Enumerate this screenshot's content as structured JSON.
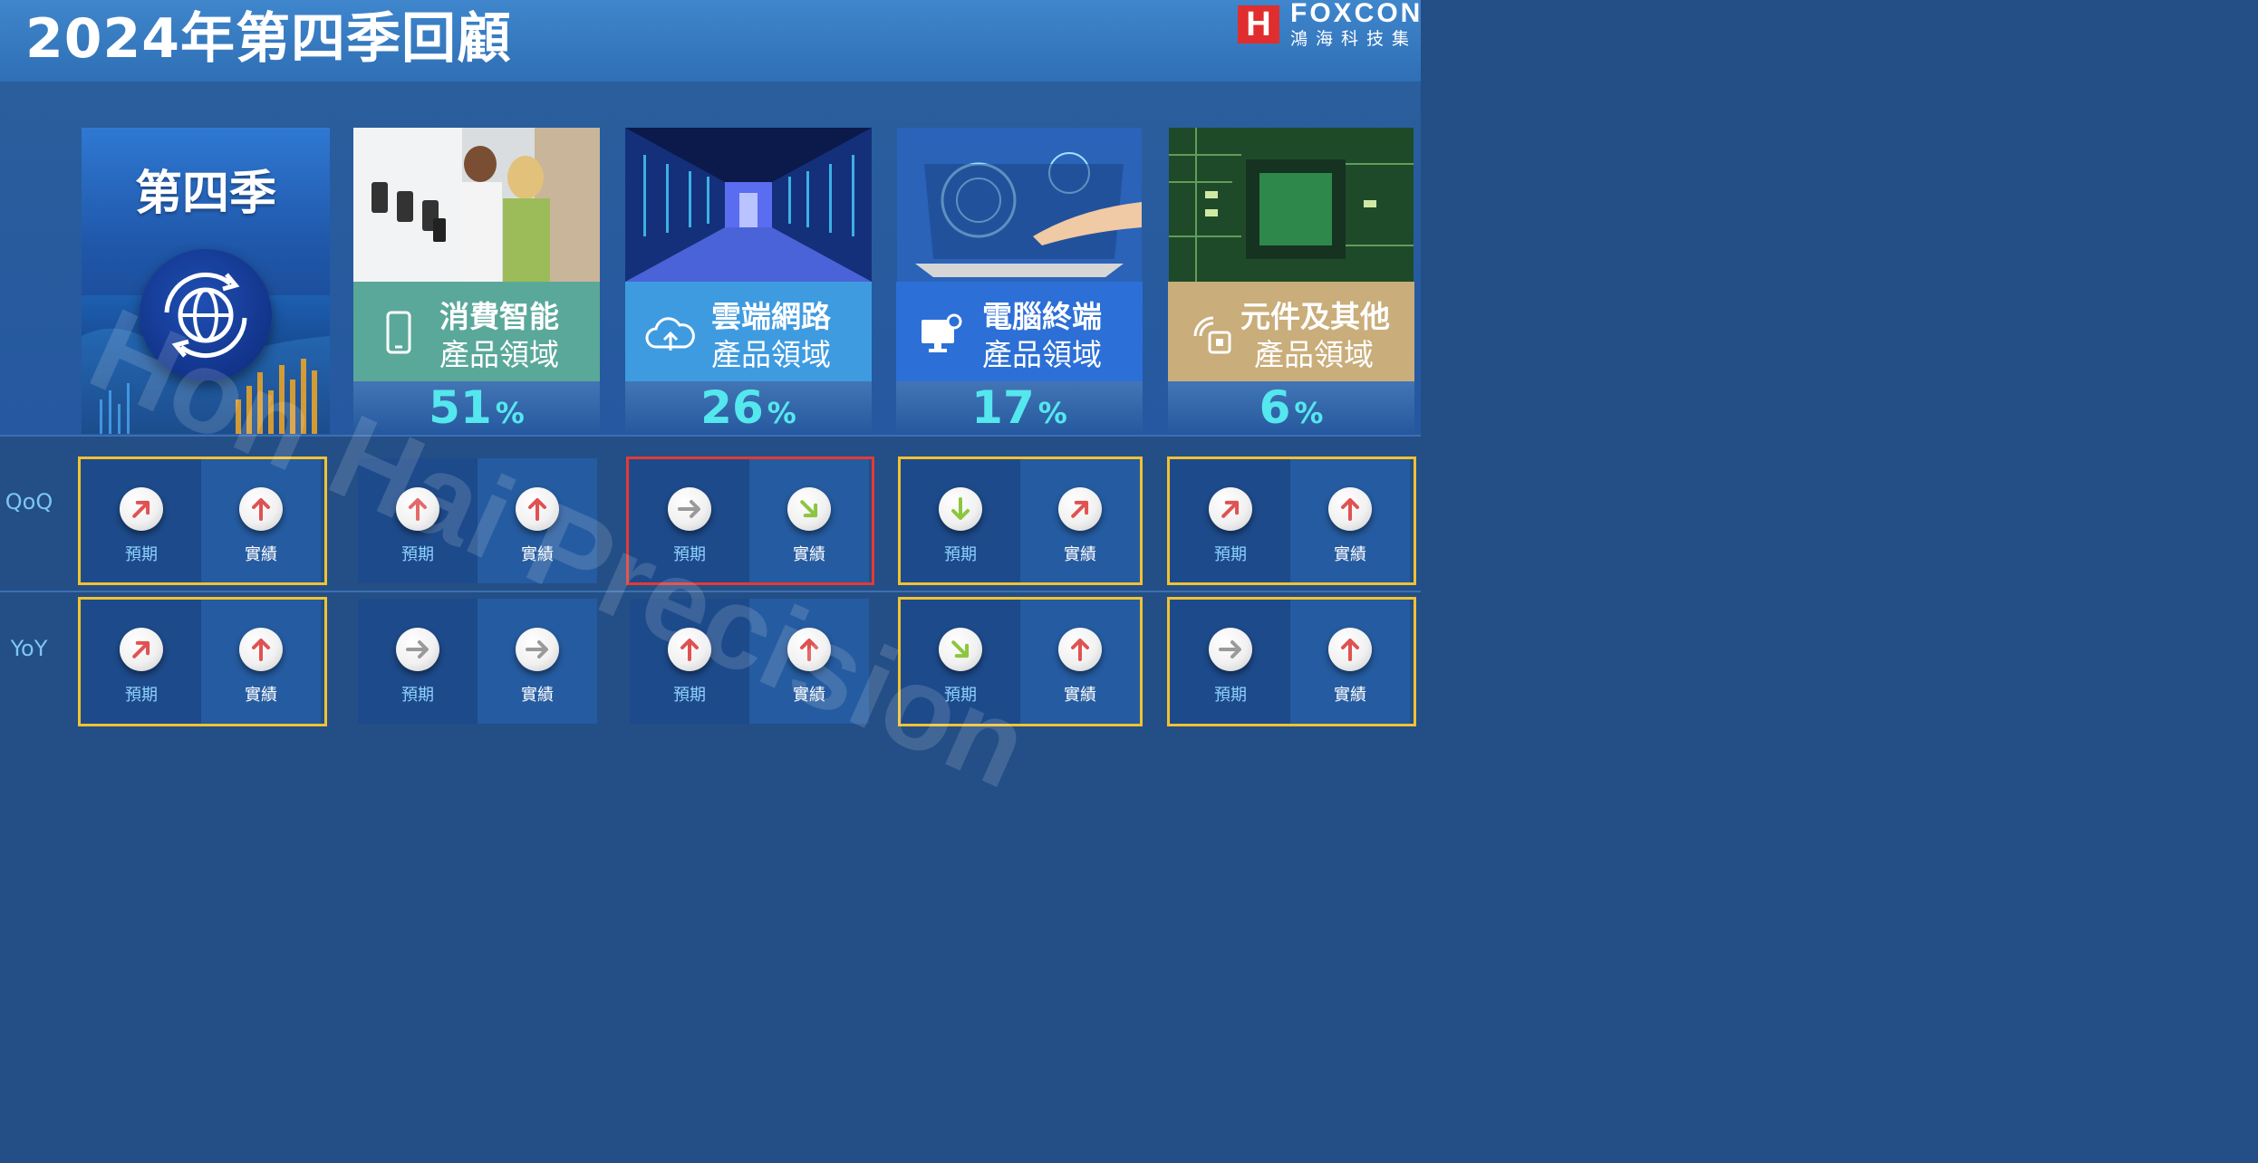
{
  "header": {
    "title": "2024年第四季回顧",
    "logo": {
      "mark": "H",
      "en": "FOXCON",
      "zh": "鴻海科技集"
    }
  },
  "q4card": {
    "title": "第四季",
    "icon": "globe-refresh-icon"
  },
  "rows": {
    "qoq": "QoQ",
    "yoy": "YoY"
  },
  "labels": {
    "expected": "預期",
    "actual": "實績"
  },
  "colors": {
    "up": "#e05252",
    "neutral": "#9a9a9a",
    "down": "#8cc63f",
    "highlight": "#f1c232",
    "alert": "#e53935",
    "pct": "#55e7ee"
  },
  "segments": [
    {
      "name_line1": "消費智能",
      "name_line2": "產品領域",
      "icon": "smartphone-icon",
      "pct": "51",
      "unit": "%",
      "bar_color": "#5aa89a",
      "qoq": {
        "expected": "up",
        "actual": "up"
      },
      "yoy": {
        "expected": "neutral",
        "actual": "neutral"
      }
    },
    {
      "name_line1": "雲端網路",
      "name_line2": "產品領域",
      "icon": "cloud-upload-icon",
      "pct": "26",
      "unit": "%",
      "bar_color": "#3f9be0",
      "qoq": {
        "expected": "neutral",
        "actual": "down-right"
      },
      "yoy": {
        "expected": "up",
        "actual": "up"
      }
    },
    {
      "name_line1": "電腦終端",
      "name_line2": "產品領域",
      "icon": "monitor-gear-icon",
      "pct": "17",
      "unit": "%",
      "bar_color": "#2c6fd6",
      "qoq": {
        "expected": "down",
        "actual": "up-right"
      },
      "yoy": {
        "expected": "down-right",
        "actual": "up"
      }
    },
    {
      "name_line1": "元件及其他",
      "name_line2": "產品領域",
      "icon": "chip-signal-icon",
      "pct": "6",
      "unit": "%",
      "bar_color": "#c9ad7a",
      "qoq": {
        "expected": "up-right",
        "actual": "up"
      },
      "yoy": {
        "expected": "neutral",
        "actual": "up"
      }
    }
  ],
  "q4_indicators": {
    "qoq": {
      "expected": "up-right",
      "actual": "up"
    },
    "yoy": {
      "expected": "up-right",
      "actual": "up"
    }
  },
  "watermark": "Hon Hai Precision"
}
